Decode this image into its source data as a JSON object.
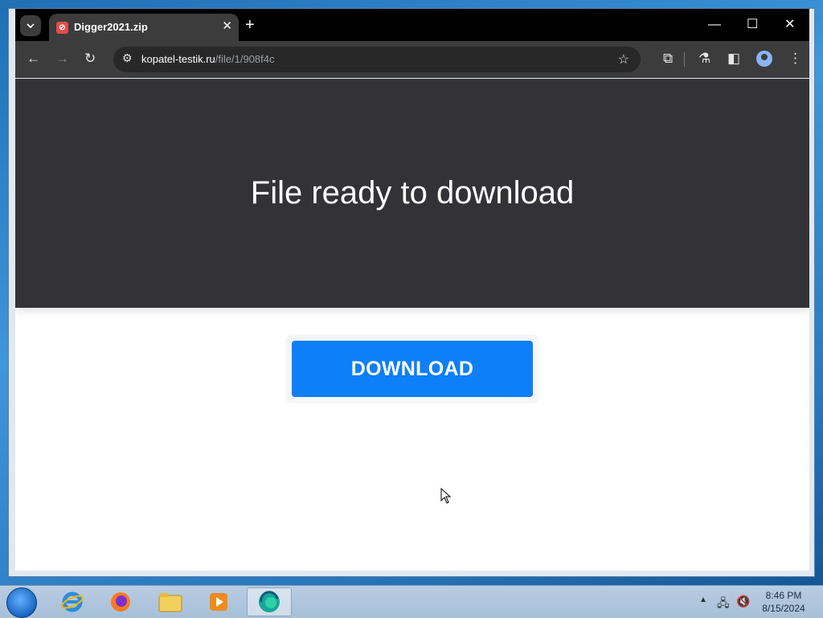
{
  "browser": {
    "tab": {
      "title": "Digger2021.zip",
      "close_label": "✕"
    },
    "new_tab_label": "+",
    "window_controls": {
      "minimize": "—",
      "maximize": "☐",
      "close": "✕"
    },
    "address": {
      "host": "kopatel-testik.ru",
      "path": "/file/1/908f4c"
    }
  },
  "page": {
    "headline": "File ready to download",
    "download_button": "DOWNLOAD",
    "colors": {
      "hero_bg": "#333237",
      "button_bg": "#0f7ff7"
    }
  },
  "taskbar": {
    "apps": [
      "internet-explorer",
      "firefox",
      "file-explorer",
      "media-player",
      "edge"
    ],
    "clock": {
      "time": "8:46 PM",
      "date": "8/15/2024"
    }
  }
}
